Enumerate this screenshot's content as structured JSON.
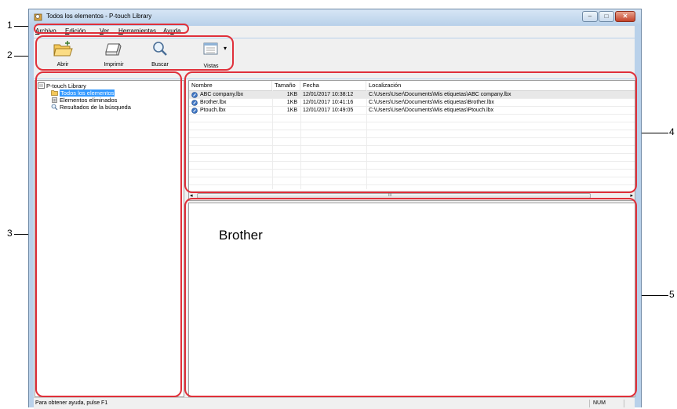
{
  "window": {
    "title": "Todos los elementos - P-touch Library",
    "minimize_glyph": "–",
    "maximize_glyph": "□",
    "close_glyph": "✕"
  },
  "menubar": {
    "items": [
      {
        "accel": "A",
        "rest": "rchivo"
      },
      {
        "accel": "E",
        "rest": "dición"
      },
      {
        "accel": "V",
        "rest": "er"
      },
      {
        "accel": "H",
        "rest": "erramientas"
      },
      {
        "pre": "Ay",
        "accel": "u",
        "rest": "da"
      }
    ]
  },
  "toolbar": {
    "open_label": "Abrir",
    "print_label": "Imprimir",
    "search_label": "Buscar",
    "views_label": "Vistas",
    "views_arrow": "▾"
  },
  "tree": {
    "root": "P-touch Library",
    "items": [
      "Todos los elementos",
      "Elementos eliminados",
      "Resultados de la búsqueda"
    ]
  },
  "list": {
    "columns": [
      "Nombre",
      "Tamaño",
      "Fecha",
      "Localización"
    ],
    "rows": [
      {
        "name": "ABC company.lbx",
        "size": "1KB",
        "date": "12/01/2017 10:38:12",
        "location": "C:\\Users\\User\\Documents\\Mis etiquetas\\ABC company.lbx"
      },
      {
        "name": "Brother.lbx",
        "size": "1KB",
        "date": "12/01/2017 10:41:16",
        "location": "C:\\Users\\User\\Documents\\Mis etiquetas\\Brother.lbx"
      },
      {
        "name": "Ptouch.lbx",
        "size": "1KB",
        "date": "12/01/2017 10:49:05",
        "location": "C:\\Users\\User\\Documents\\Mis etiquetas\\Ptouch.lbx"
      }
    ],
    "scroll_left": "◂",
    "scroll_right": "▸",
    "thumb_grip": "III"
  },
  "preview": {
    "text": "Brother"
  },
  "statusbar": {
    "help": "Para obtener ayuda, pulse F1",
    "num": "NUM"
  },
  "callouts": [
    "1",
    "2",
    "3",
    "4",
    "5"
  ],
  "colors": {
    "callout": "#e0303a",
    "selection": "#3399ff",
    "frame": "#b9d1ea"
  }
}
